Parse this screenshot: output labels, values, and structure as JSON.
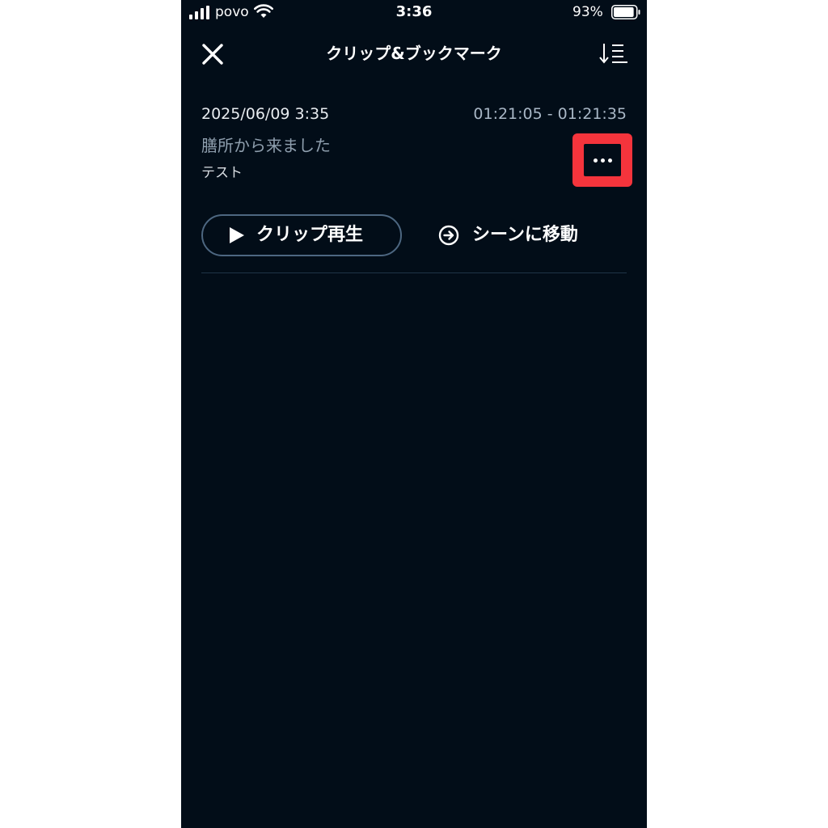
{
  "status_bar": {
    "carrier": "povo",
    "time": "3:36",
    "battery_percent": "93%",
    "battery_level": 0.93
  },
  "header": {
    "title": "クリップ&ブックマーク",
    "close_icon": "close-icon",
    "sort_icon": "sort-icon"
  },
  "clip": {
    "date": "2025/06/09 3:35",
    "range": "01:21:05 - 01:21:35",
    "title": "膳所から来ました",
    "memo": "テスト",
    "more_icon": "more-horizontal-icon",
    "play_label": "クリップ再生",
    "goto_label": "シーンに移動"
  },
  "colors": {
    "background": "#020d18",
    "highlight": "#f5343c",
    "button_border": "#4d6781",
    "muted_text": "#8f9fae"
  }
}
